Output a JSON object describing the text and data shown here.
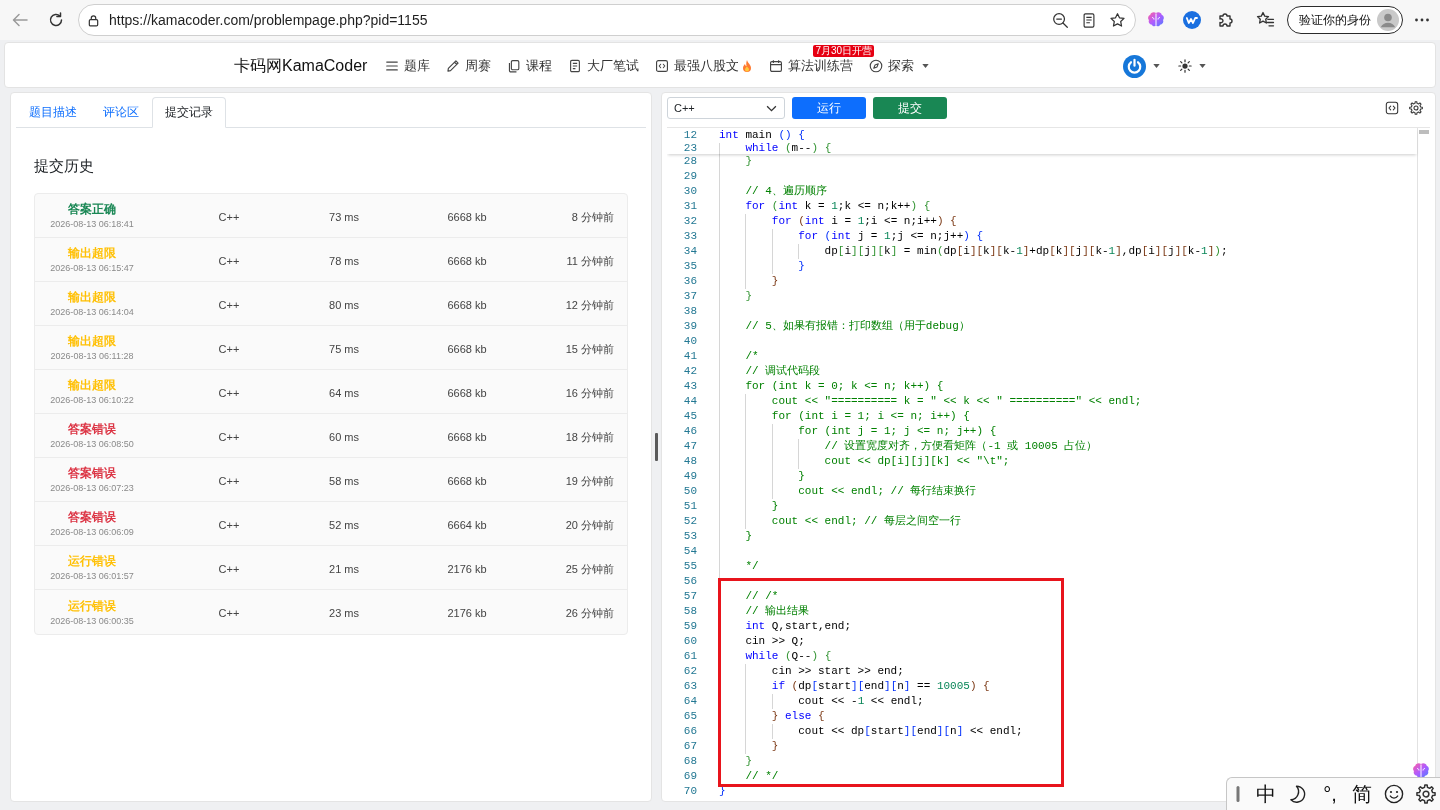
{
  "browser": {
    "url": "https://kamacoder.com/problempage.php?pid=1155",
    "profile_button": "验证你的身份"
  },
  "site_header": {
    "brand": "卡码网KamaCoder",
    "nav_items": [
      {
        "label": "题库",
        "hot": false,
        "dropdown": false
      },
      {
        "label": "周赛",
        "hot": false,
        "dropdown": false
      },
      {
        "label": "课程",
        "hot": false,
        "dropdown": false
      },
      {
        "label": "大厂笔试",
        "hot": false,
        "dropdown": false
      },
      {
        "label": "最强八股文",
        "hot": true,
        "dropdown": false
      },
      {
        "label": "算法训练营",
        "hot": false,
        "dropdown": false,
        "badge": "7月30日开营"
      },
      {
        "label": "探索",
        "hot": false,
        "dropdown": true
      }
    ]
  },
  "submissions_panel": {
    "tabs": [
      {
        "label": "题目描述",
        "selected": false
      },
      {
        "label": "评论区",
        "selected": false
      },
      {
        "label": "提交记录",
        "selected": true
      }
    ],
    "heading": "提交历史",
    "submissions": [
      {
        "status": "答案正确",
        "color": "#198754",
        "time": "2026-08-13 06:18:41",
        "language": "C++",
        "runtime": "73 ms",
        "memory": "6668 kb",
        "ago": "8 分钟前"
      },
      {
        "status": "输出超限",
        "color": "#ffc107",
        "time": "2026-08-13 06:15:47",
        "language": "C++",
        "runtime": "78 ms",
        "memory": "6668 kb",
        "ago": "11 分钟前"
      },
      {
        "status": "输出超限",
        "color": "#ffc107",
        "time": "2026-08-13 06:14:04",
        "language": "C++",
        "runtime": "80 ms",
        "memory": "6668 kb",
        "ago": "12 分钟前"
      },
      {
        "status": "输出超限",
        "color": "#ffc107",
        "time": "2026-08-13 06:11:28",
        "language": "C++",
        "runtime": "75 ms",
        "memory": "6668 kb",
        "ago": "15 分钟前"
      },
      {
        "status": "输出超限",
        "color": "#ffc107",
        "time": "2026-08-13 06:10:22",
        "language": "C++",
        "runtime": "64 ms",
        "memory": "6668 kb",
        "ago": "16 分钟前"
      },
      {
        "status": "答案错误",
        "color": "#dc3545",
        "time": "2026-08-13 06:08:50",
        "language": "C++",
        "runtime": "60 ms",
        "memory": "6668 kb",
        "ago": "18 分钟前"
      },
      {
        "status": "答案错误",
        "color": "#dc3545",
        "time": "2026-08-13 06:07:23",
        "language": "C++",
        "runtime": "58 ms",
        "memory": "6668 kb",
        "ago": "19 分钟前"
      },
      {
        "status": "答案错误",
        "color": "#dc3545",
        "time": "2026-08-13 06:06:09",
        "language": "C++",
        "runtime": "52 ms",
        "memory": "6664 kb",
        "ago": "20 分钟前"
      },
      {
        "status": "运行错误",
        "color": "#ffc107",
        "time": "2026-08-13 06:01:57",
        "language": "C++",
        "runtime": "21 ms",
        "memory": "2176 kb",
        "ago": "25 分钟前"
      },
      {
        "status": "运行错误",
        "color": "#ffc107",
        "time": "2026-08-13 06:00:35",
        "language": "C++",
        "runtime": "23 ms",
        "memory": "2176 kb",
        "ago": "26 分钟前"
      }
    ]
  },
  "editor_panel": {
    "language": "C++",
    "buttons": [
      {
        "label": "运行",
        "kind": "run"
      },
      {
        "label": "提交",
        "kind": "submit"
      }
    ],
    "sticky_lines": [
      {
        "number": "12",
        "tokens": [
          {
            "kind": "keyword",
            "text": "int"
          },
          {
            "kind": "plain",
            "text": " main "
          },
          {
            "kind": "bracket1",
            "text": "()"
          },
          {
            "kind": "bracket1",
            "text": " {"
          }
        ]
      },
      {
        "number": "23",
        "tokens": [
          {
            "kind": "keyword",
            "text": "    while"
          },
          {
            "kind": "bracket2",
            "text": " ("
          },
          {
            "kind": "plain",
            "text": "m--"
          },
          {
            "kind": "bracket2",
            "text": ")"
          },
          {
            "kind": "bracket2",
            "text": " {"
          }
        ]
      }
    ],
    "lines": [
      {
        "number": "28",
        "tokens": [
          {
            "kind": "bracket2",
            "text": "    }"
          }
        ]
      },
      {
        "number": "29"
      },
      {
        "number": "30",
        "tokens": [
          {
            "kind": "comment",
            "text": "    // 4、遍历顺序"
          }
        ]
      },
      {
        "number": "31",
        "tokens": [
          {
            "kind": "keyword",
            "text": "    for"
          },
          {
            "kind": "bracket2",
            "text": " ("
          },
          {
            "kind": "keyword",
            "text": "int"
          },
          {
            "kind": "plain",
            "text": " k = "
          },
          {
            "kind": "number",
            "text": "1"
          },
          {
            "kind": "plain",
            "text": ";k <= n;k++"
          },
          {
            "kind": "bracket2",
            "text": ")"
          },
          {
            "kind": "bracket2",
            "text": " {"
          }
        ]
      },
      {
        "number": "32",
        "tokens": [
          {
            "kind": "keyword",
            "text": "        for"
          },
          {
            "kind": "bracket3",
            "text": " ("
          },
          {
            "kind": "keyword",
            "text": "int"
          },
          {
            "kind": "plain",
            "text": " i = "
          },
          {
            "kind": "number",
            "text": "1"
          },
          {
            "kind": "plain",
            "text": ";i <= n;i++"
          },
          {
            "kind": "bracket3",
            "text": ")"
          },
          {
            "kind": "bracket3",
            "text": " {"
          }
        ]
      },
      {
        "number": "33",
        "tokens": [
          {
            "kind": "keyword",
            "text": "            for"
          },
          {
            "kind": "bracket1",
            "text": " ("
          },
          {
            "kind": "keyword",
            "text": "int"
          },
          {
            "kind": "plain",
            "text": " j = "
          },
          {
            "kind": "number",
            "text": "1"
          },
          {
            "kind": "plain",
            "text": ";j <= n;j++"
          },
          {
            "kind": "bracket1",
            "text": ")"
          },
          {
            "kind": "bracket1",
            "text": " {"
          }
        ]
      },
      {
        "number": "34",
        "tokens": [
          {
            "kind": "plain",
            "text": "                dp"
          },
          {
            "kind": "bracket2",
            "text": "["
          },
          {
            "kind": "plain",
            "text": "i"
          },
          {
            "kind": "bracket2",
            "text": "]["
          },
          {
            "kind": "plain",
            "text": "j"
          },
          {
            "kind": "bracket2",
            "text": "]["
          },
          {
            "kind": "plain",
            "text": "k"
          },
          {
            "kind": "bracket2",
            "text": "]"
          },
          {
            "kind": "plain",
            "text": " = min"
          },
          {
            "kind": "bracket2",
            "text": "("
          },
          {
            "kind": "plain",
            "text": "dp"
          },
          {
            "kind": "bracket3",
            "text": "["
          },
          {
            "kind": "plain",
            "text": "i"
          },
          {
            "kind": "bracket3",
            "text": "]["
          },
          {
            "kind": "plain",
            "text": "k"
          },
          {
            "kind": "bracket3",
            "text": "]["
          },
          {
            "kind": "plain",
            "text": "k-"
          },
          {
            "kind": "number",
            "text": "1"
          },
          {
            "kind": "bracket3",
            "text": "]"
          },
          {
            "kind": "plain",
            "text": "+dp"
          },
          {
            "kind": "bracket3",
            "text": "["
          },
          {
            "kind": "plain",
            "text": "k"
          },
          {
            "kind": "bracket3",
            "text": "]["
          },
          {
            "kind": "plain",
            "text": "j"
          },
          {
            "kind": "bracket3",
            "text": "]["
          },
          {
            "kind": "plain",
            "text": "k-"
          },
          {
            "kind": "number",
            "text": "1"
          },
          {
            "kind": "bracket3",
            "text": "]"
          },
          {
            "kind": "plain",
            "text": ",dp"
          },
          {
            "kind": "bracket3",
            "text": "["
          },
          {
            "kind": "plain",
            "text": "i"
          },
          {
            "kind": "bracket3",
            "text": "]["
          },
          {
            "kind": "plain",
            "text": "j"
          },
          {
            "kind": "bracket3",
            "text": "]["
          },
          {
            "kind": "plain",
            "text": "k-"
          },
          {
            "kind": "number",
            "text": "1"
          },
          {
            "kind": "bracket3",
            "text": "]"
          },
          {
            "kind": "bracket2",
            "text": ")"
          },
          {
            "kind": "plain",
            "text": ";"
          }
        ]
      },
      {
        "number": "35",
        "tokens": [
          {
            "kind": "bracket1",
            "text": "            }"
          }
        ]
      },
      {
        "number": "36",
        "tokens": [
          {
            "kind": "bracket3",
            "text": "        }"
          }
        ]
      },
      {
        "number": "37",
        "tokens": [
          {
            "kind": "bracket2",
            "text": "    }"
          }
        ]
      },
      {
        "number": "38"
      },
      {
        "number": "39",
        "tokens": [
          {
            "kind": "comment",
            "text": "    // 5、如果有报错：打印数组（用于debug）"
          }
        ]
      },
      {
        "number": "40"
      },
      {
        "number": "41",
        "tokens": [
          {
            "kind": "comment",
            "text": "    /*"
          }
        ]
      },
      {
        "number": "42",
        "tokens": [
          {
            "kind": "comment",
            "text": "    // 调试代码段"
          }
        ]
      },
      {
        "number": "43",
        "tokens": [
          {
            "kind": "comment",
            "text": "    for (int k = 0; k <= n; k++) {"
          }
        ]
      },
      {
        "number": "44",
        "tokens": [
          {
            "kind": "comment",
            "text": "        cout << \"========== k = \" << k << \" ==========\" << endl;"
          }
        ]
      },
      {
        "number": "45",
        "tokens": [
          {
            "kind": "comment",
            "text": "        for (int i = 1; i <= n; i++) {"
          }
        ]
      },
      {
        "number": "46",
        "tokens": [
          {
            "kind": "comment",
            "text": "            for (int j = 1; j <= n; j++) {"
          }
        ]
      },
      {
        "number": "47",
        "tokens": [
          {
            "kind": "comment",
            "text": "                // 设置宽度对齐，方便看矩阵（-1 或 10005 占位）"
          }
        ]
      },
      {
        "number": "48",
        "tokens": [
          {
            "kind": "comment",
            "text": "                cout << dp[i][j][k] << \"\\t\";"
          }
        ]
      },
      {
        "number": "49",
        "tokens": [
          {
            "kind": "comment",
            "text": "            }"
          }
        ]
      },
      {
        "number": "50",
        "tokens": [
          {
            "kind": "comment",
            "text": "            cout << endl; // 每行结束换行"
          }
        ]
      },
      {
        "number": "51",
        "tokens": [
          {
            "kind": "comment",
            "text": "        }"
          }
        ]
      },
      {
        "number": "52",
        "tokens": [
          {
            "kind": "comment",
            "text": "        cout << endl; // 每层之间空一行"
          }
        ]
      },
      {
        "number": "53",
        "tokens": [
          {
            "kind": "comment",
            "text": "    }"
          }
        ]
      },
      {
        "number": "54"
      },
      {
        "number": "55",
        "tokens": [
          {
            "kind": "comment",
            "text": "    */"
          }
        ]
      },
      {
        "number": "56"
      },
      {
        "number": "57",
        "tokens": [
          {
            "kind": "comment",
            "text": "    // /*"
          }
        ]
      },
      {
        "number": "58",
        "tokens": [
          {
            "kind": "comment",
            "text": "    // 输出结果"
          }
        ]
      },
      {
        "number": "59",
        "tokens": [
          {
            "kind": "keyword",
            "text": "    int"
          },
          {
            "kind": "plain",
            "text": " Q,start,end;"
          }
        ]
      },
      {
        "number": "60",
        "tokens": [
          {
            "kind": "plain",
            "text": "    cin >> Q;"
          }
        ]
      },
      {
        "number": "61",
        "tokens": [
          {
            "kind": "keyword",
            "text": "    while"
          },
          {
            "kind": "bracket2",
            "text": " ("
          },
          {
            "kind": "plain",
            "text": "Q--"
          },
          {
            "kind": "bracket2",
            "text": ")"
          },
          {
            "kind": "bracket2",
            "text": " {"
          }
        ]
      },
      {
        "number": "62",
        "tokens": [
          {
            "kind": "plain",
            "text": "        cin >> start >> end;"
          }
        ]
      },
      {
        "number": "63",
        "tokens": [
          {
            "kind": "keyword",
            "text": "        if"
          },
          {
            "kind": "bracket3",
            "text": " ("
          },
          {
            "kind": "plain",
            "text": "dp"
          },
          {
            "kind": "bracket1",
            "text": "["
          },
          {
            "kind": "plain",
            "text": "start"
          },
          {
            "kind": "bracket1",
            "text": "]["
          },
          {
            "kind": "plain",
            "text": "end"
          },
          {
            "kind": "bracket1",
            "text": "]["
          },
          {
            "kind": "plain",
            "text": "n"
          },
          {
            "kind": "bracket1",
            "text": "]"
          },
          {
            "kind": "plain",
            "text": " == "
          },
          {
            "kind": "number",
            "text": "10005"
          },
          {
            "kind": "bracket3",
            "text": ")"
          },
          {
            "kind": "bracket3",
            "text": " {"
          }
        ]
      },
      {
        "number": "64",
        "tokens": [
          {
            "kind": "plain",
            "text": "            cout << -"
          },
          {
            "kind": "number",
            "text": "1"
          },
          {
            "kind": "plain",
            "text": " << endl;"
          }
        ]
      },
      {
        "number": "65",
        "tokens": [
          {
            "kind": "bracket3",
            "text": "        }"
          },
          {
            "kind": "keyword",
            "text": " else"
          },
          {
            "kind": "bracket3",
            "text": " {"
          }
        ]
      },
      {
        "number": "66",
        "tokens": [
          {
            "kind": "plain",
            "text": "            cout << dp"
          },
          {
            "kind": "bracket1",
            "text": "["
          },
          {
            "kind": "plain",
            "text": "start"
          },
          {
            "kind": "bracket1",
            "text": "]["
          },
          {
            "kind": "plain",
            "text": "end"
          },
          {
            "kind": "bracket1",
            "text": "]["
          },
          {
            "kind": "plain",
            "text": "n"
          },
          {
            "kind": "bracket1",
            "text": "]"
          },
          {
            "kind": "plain",
            "text": " << endl;"
          }
        ]
      },
      {
        "number": "67",
        "tokens": [
          {
            "kind": "bracket3",
            "text": "        }"
          }
        ]
      },
      {
        "number": "68",
        "tokens": [
          {
            "kind": "bracket2",
            "text": "    }"
          }
        ]
      },
      {
        "number": "69",
        "tokens": [
          {
            "kind": "comment",
            "text": "    // */"
          }
        ]
      },
      {
        "number": "70",
        "tokens": [
          {
            "kind": "bracket1",
            "text": "}"
          }
        ]
      }
    ]
  },
  "ime_toolbar": {
    "input_mode": "中",
    "punctuation": "°,",
    "script": "简"
  }
}
